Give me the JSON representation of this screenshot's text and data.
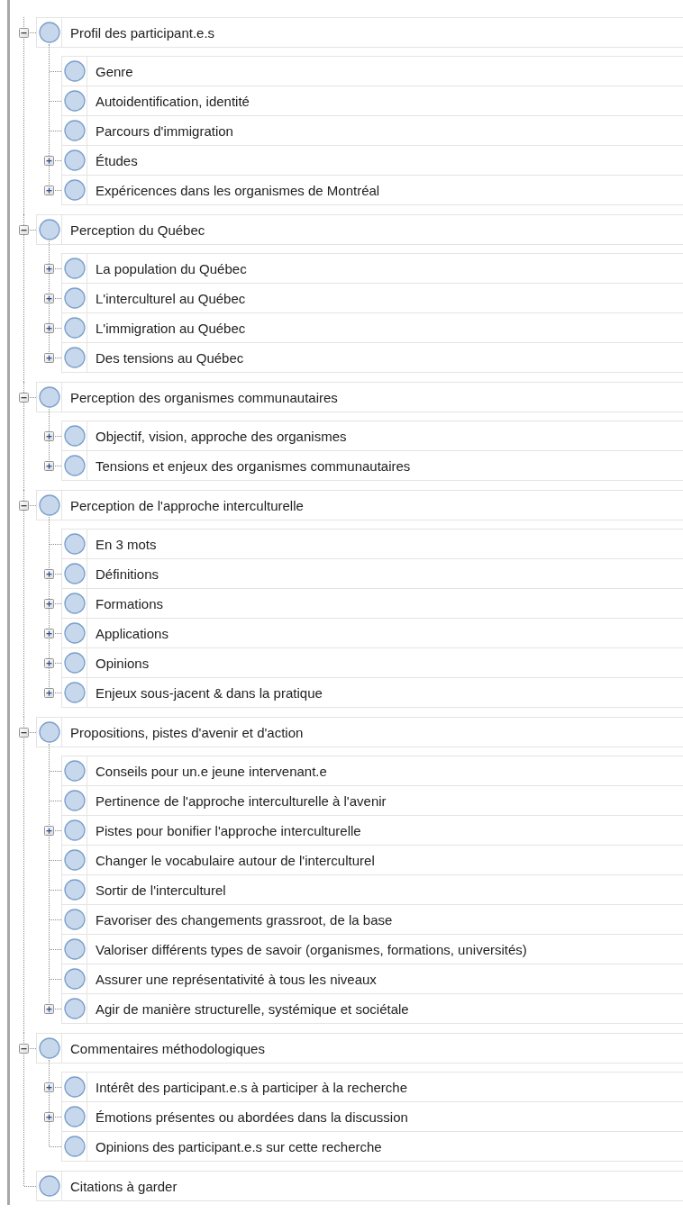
{
  "tree": [
    {
      "label": "Profil des participant.e.s",
      "kind": "branch",
      "expanded": true,
      "children": [
        {
          "label": "Genre",
          "kind": "leaf"
        },
        {
          "label": "Autoidentification, identité",
          "kind": "leaf"
        },
        {
          "label": "Parcours d'immigration",
          "kind": "leaf"
        },
        {
          "label": "Études",
          "kind": "branch",
          "expanded": false
        },
        {
          "label": "Expéricences dans les organismes de Montréal",
          "kind": "branch",
          "expanded": false
        }
      ]
    },
    {
      "label": "Perception du Québec",
      "kind": "branch",
      "expanded": true,
      "children": [
        {
          "label": "La population du Québec",
          "kind": "branch",
          "expanded": false
        },
        {
          "label": "L'interculturel au Québec",
          "kind": "branch",
          "expanded": false
        },
        {
          "label": "L'immigration au Québec",
          "kind": "branch",
          "expanded": false
        },
        {
          "label": "Des tensions au Québec",
          "kind": "branch",
          "expanded": false
        }
      ]
    },
    {
      "label": "Perception des organismes communautaires",
      "kind": "branch",
      "expanded": true,
      "children": [
        {
          "label": "Objectif, vision, approche des organismes",
          "kind": "branch",
          "expanded": false
        },
        {
          "label": "Tensions et enjeux des organismes communautaires",
          "kind": "branch",
          "expanded": false
        }
      ]
    },
    {
      "label": "Perception de l'approche interculturelle",
      "kind": "branch",
      "expanded": true,
      "children": [
        {
          "label": "En 3 mots",
          "kind": "leaf"
        },
        {
          "label": "Définitions",
          "kind": "branch",
          "expanded": false
        },
        {
          "label": "Formations",
          "kind": "branch",
          "expanded": false
        },
        {
          "label": "Applications",
          "kind": "branch",
          "expanded": false
        },
        {
          "label": "Opinions",
          "kind": "branch",
          "expanded": false
        },
        {
          "label": "Enjeux sous-jacent & dans la pratique",
          "kind": "branch",
          "expanded": false
        }
      ]
    },
    {
      "label": "Propositions, pistes d'avenir et d'action",
      "kind": "branch",
      "expanded": true,
      "children": [
        {
          "label": "Conseils pour un.e jeune intervenant.e",
          "kind": "leaf"
        },
        {
          "label": "Pertinence de l'approche interculturelle à l'avenir",
          "kind": "leaf"
        },
        {
          "label": "Pistes pour bonifier l'approche interculturelle",
          "kind": "branch",
          "expanded": false
        },
        {
          "label": "Changer le vocabulaire autour de l'interculturel",
          "kind": "leaf"
        },
        {
          "label": "Sortir de l'interculturel",
          "kind": "leaf"
        },
        {
          "label": "Favoriser des changements grassroot, de la base",
          "kind": "leaf"
        },
        {
          "label": "Valoriser différents types de savoir (organismes, formations, universités)",
          "kind": "leaf"
        },
        {
          "label": "Assurer une représentativité à tous les niveaux",
          "kind": "leaf"
        },
        {
          "label": "Agir de manière structurelle, systémique et sociétale",
          "kind": "branch",
          "expanded": false
        }
      ]
    },
    {
      "label": "Commentaires méthodologiques",
      "kind": "branch",
      "expanded": true,
      "children": [
        {
          "label": "Intérêt des participant.e.s à participer à la recherche",
          "kind": "branch",
          "expanded": false
        },
        {
          "label": "Émotions présentes ou abordées dans la discussion",
          "kind": "branch",
          "expanded": false
        },
        {
          "label": "Opinions des participant.e.s sur cette recherche",
          "kind": "leaf"
        }
      ]
    },
    {
      "label": "Citations à garder",
      "kind": "leaf"
    }
  ]
}
